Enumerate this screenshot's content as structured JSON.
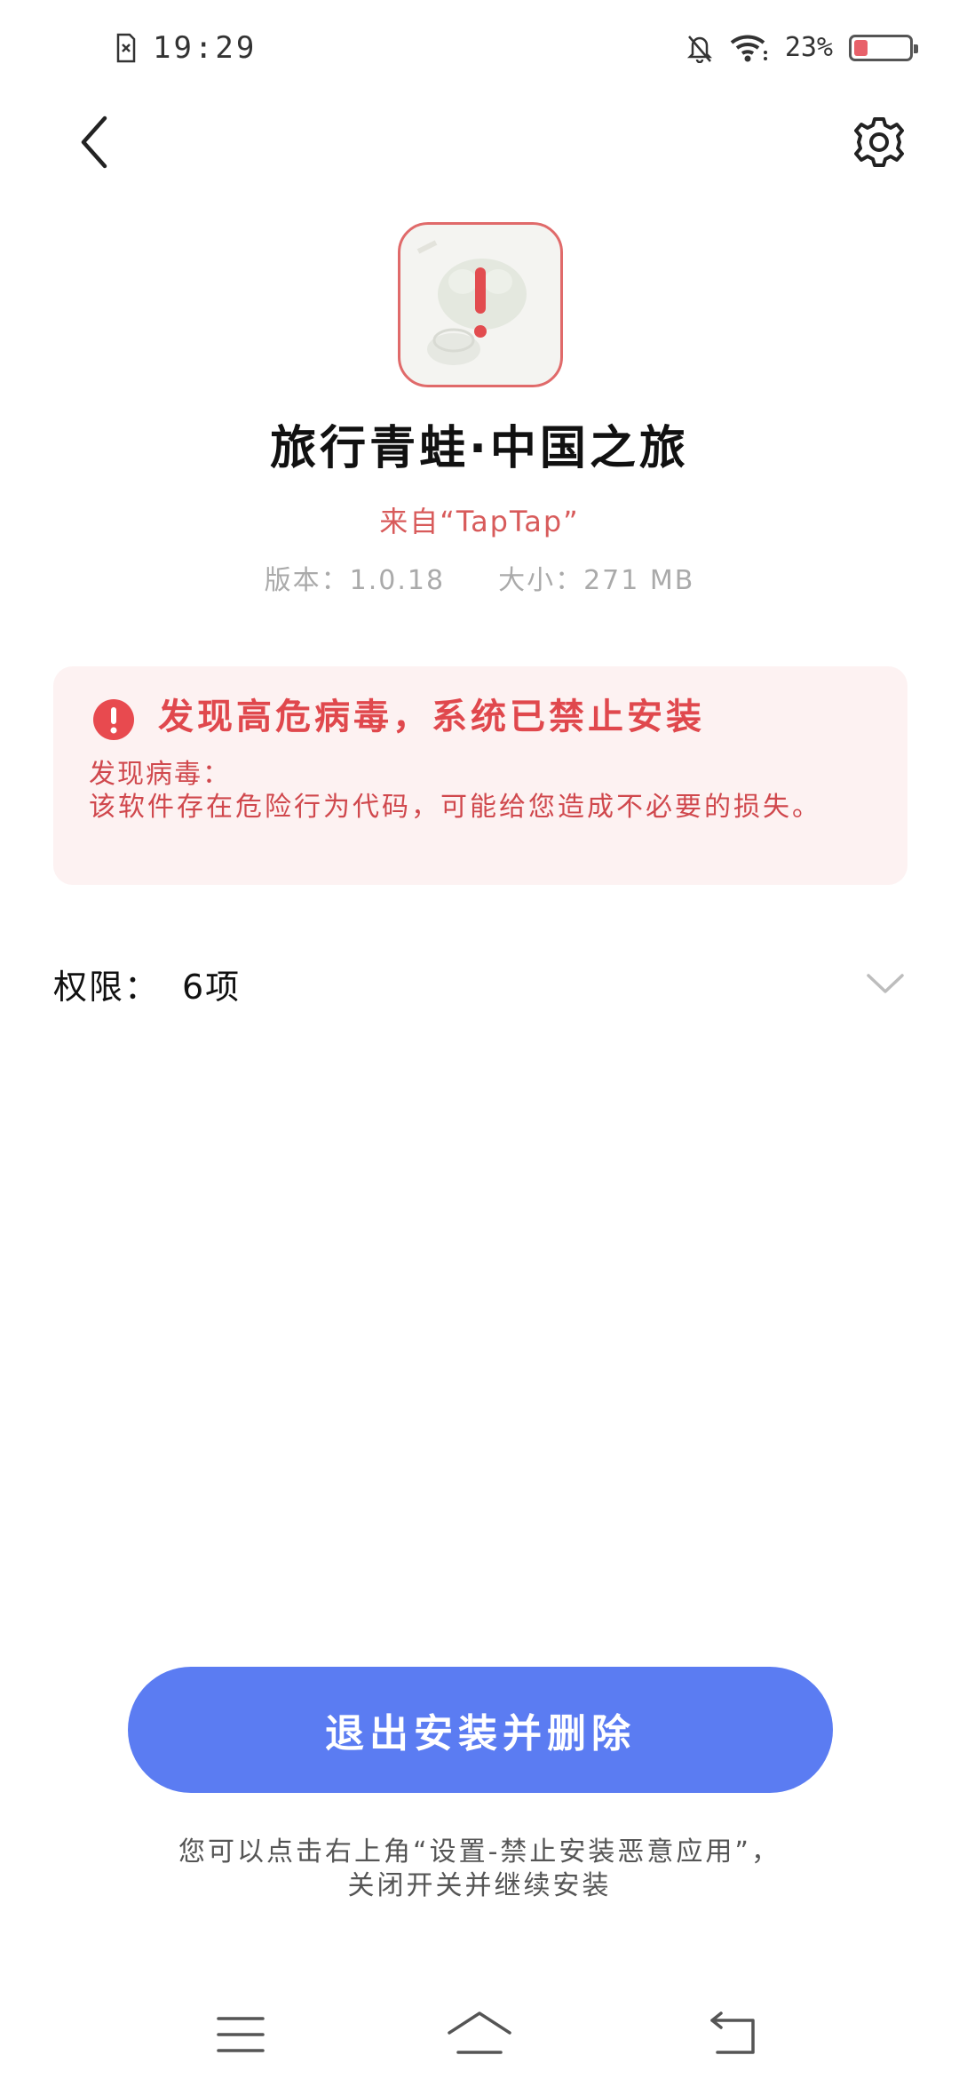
{
  "status_bar": {
    "time": "19:29",
    "battery_text": "23%",
    "battery_level": 0.23,
    "icons": [
      "sim-error-icon",
      "mute-notification-icon",
      "wifi-icon",
      "battery-icon"
    ]
  },
  "nav": {
    "back_icon": "chevron-left-icon",
    "settings_icon": "gear-icon"
  },
  "app": {
    "icon": "app-warning-icon",
    "name": "旅行青蛙·中国之旅",
    "source": "来自“TapTap”",
    "version_label": "版本：",
    "version": "1.0.18",
    "size_label": "大小：",
    "size": "271 MB"
  },
  "warning": {
    "icon": "alert-circle-icon",
    "title": "发现高危病毒，系统已禁止安装",
    "subtitle": "发现病毒：",
    "body": "该软件存在危险行为代码，可能给您造成不必要的损失。",
    "color": "#e0484d",
    "background": "#fdf2f2"
  },
  "permissions": {
    "label": "权限：",
    "count": "6项",
    "chevron": "chevron-down-icon"
  },
  "actions": {
    "exit_label": "退出安装并删除",
    "button_color": "#5b7cf2"
  },
  "hint": {
    "line1": "您可以点击右上角“设置-禁止安装恶意应用”，",
    "line2": "关闭开关并继续安装"
  },
  "navbar": {
    "icons": [
      "menu-icon",
      "home-icon",
      "back-nav-icon"
    ]
  }
}
